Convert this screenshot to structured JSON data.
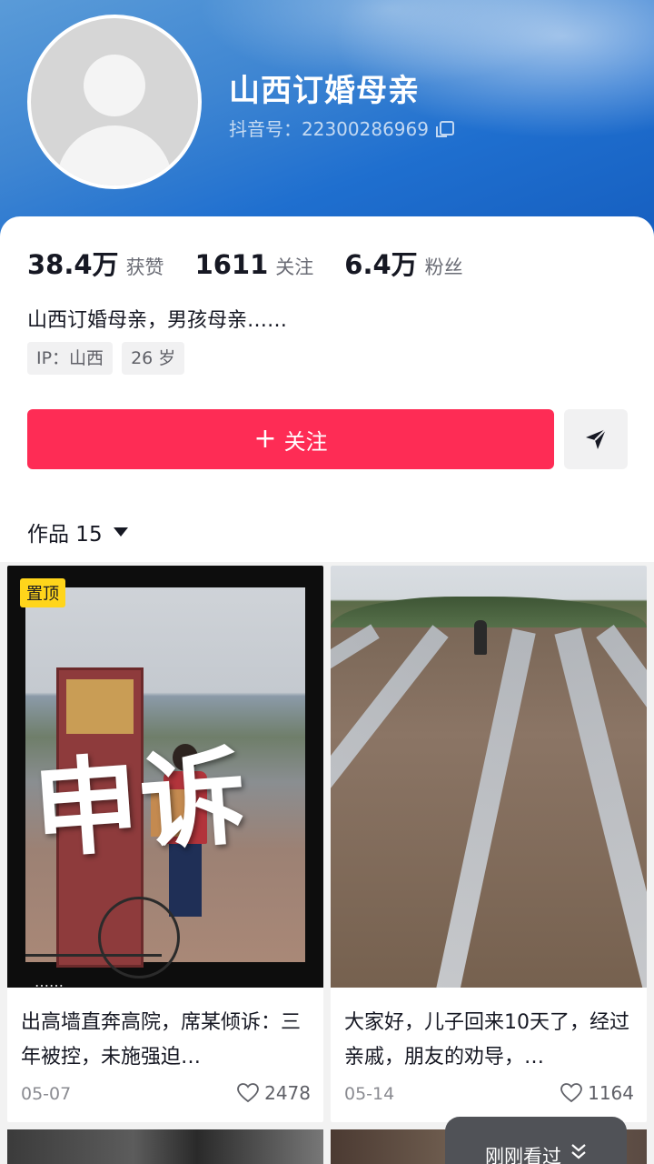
{
  "profile": {
    "name": "山西订婚母亲",
    "douyin_id": "抖音号：2230028696​9",
    "stats": [
      {
        "value": "38.4万",
        "label": "获赞"
      },
      {
        "value": "1611",
        "label": "关注"
      },
      {
        "value": "6.4万",
        "label": "粉丝"
      }
    ],
    "bio": "山西订婚母亲，男孩母亲……",
    "tags": [
      "IP：山西",
      "26 岁"
    ]
  },
  "actions": {
    "follow_label": "关注",
    "follow_color": "#fe2c55"
  },
  "works": {
    "label": "作品 15"
  },
  "videos": [
    {
      "pinned_label": "置顶",
      "overlay_text": "申诉",
      "bottom_text": "……",
      "title": "出高墙直奔高院，席某倾诉：三年被控，未施强迫…",
      "date": "05-07",
      "likes": "2478"
    },
    {
      "title": "大家好，儿子回来10天了，经过亲戚，朋友的劝导，…",
      "date": "05-14",
      "likes": "1164"
    }
  ],
  "recent": {
    "label": "刚刚看过"
  },
  "icons": {
    "share": "share-arrow-icon",
    "copy": "copy-icon",
    "heart": "heart-icon",
    "caret": "caret-down-icon",
    "chevron": "double-chevron-down-icon"
  }
}
